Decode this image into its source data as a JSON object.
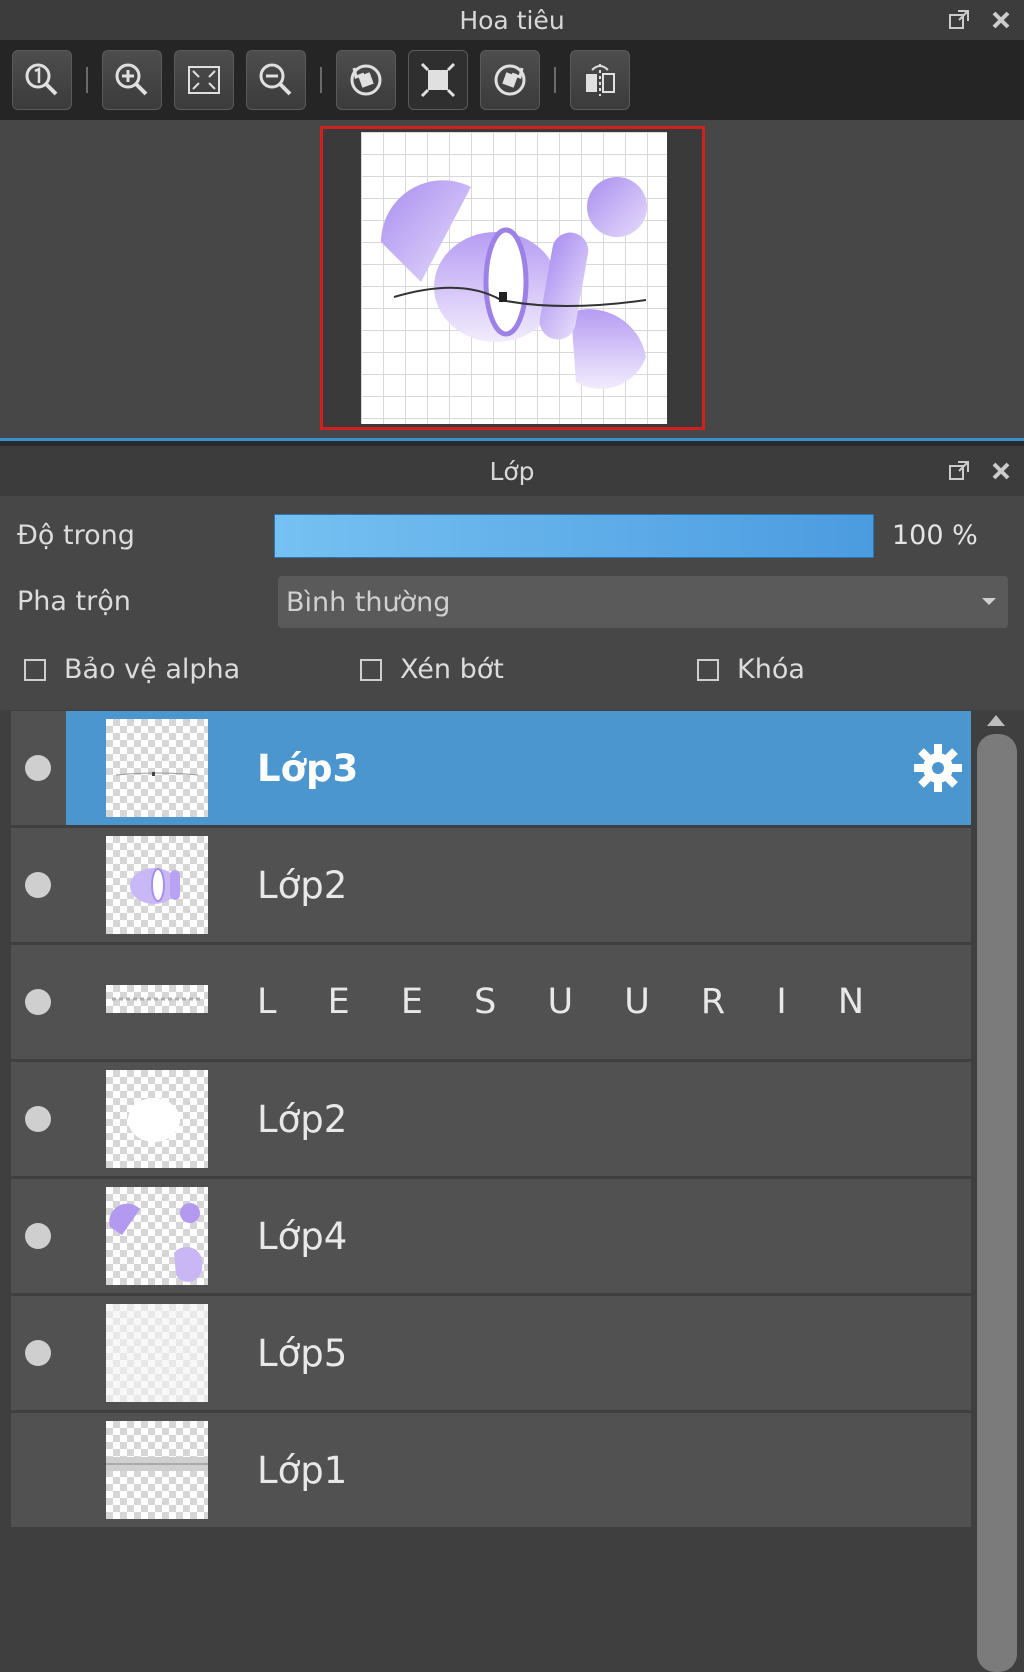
{
  "navigator": {
    "title": "Hoa tiêu",
    "toolbar_icons": [
      "zoom-actual-icon",
      "zoom-in-icon",
      "fit-screen-icon",
      "zoom-out-icon",
      "rotate-left-icon",
      "fit-canvas-icon",
      "rotate-right-icon",
      "flip-horizontal-icon"
    ]
  },
  "layers_panel": {
    "title": "Lớp",
    "opacity_label": "Độ trong",
    "opacity_value": "100 %",
    "opacity_level": 1.0,
    "blend_label": "Pha trộn",
    "blend_value": "Bình thường",
    "checkboxes": {
      "protect_alpha": "Bảo vệ alpha",
      "clip": "Xén bớt",
      "lock": "Khóa"
    },
    "layers": [
      {
        "name": "Lớp3",
        "selected": true,
        "visible": true
      },
      {
        "name": "Lớp2",
        "selected": false,
        "visible": true
      },
      {
        "name": "L E E S U U R I N",
        "selected": false,
        "visible": true
      },
      {
        "name": "Lớp2",
        "selected": false,
        "visible": true
      },
      {
        "name": "Lớp4",
        "selected": false,
        "visible": true
      },
      {
        "name": "Lớp5",
        "selected": false,
        "visible": true
      },
      {
        "name": "Lớp1",
        "selected": false,
        "visible": false
      }
    ]
  },
  "colors": {
    "selection": "#4b96cf",
    "accent_purple": "#b79cf0",
    "preview_border": "#d02020"
  }
}
